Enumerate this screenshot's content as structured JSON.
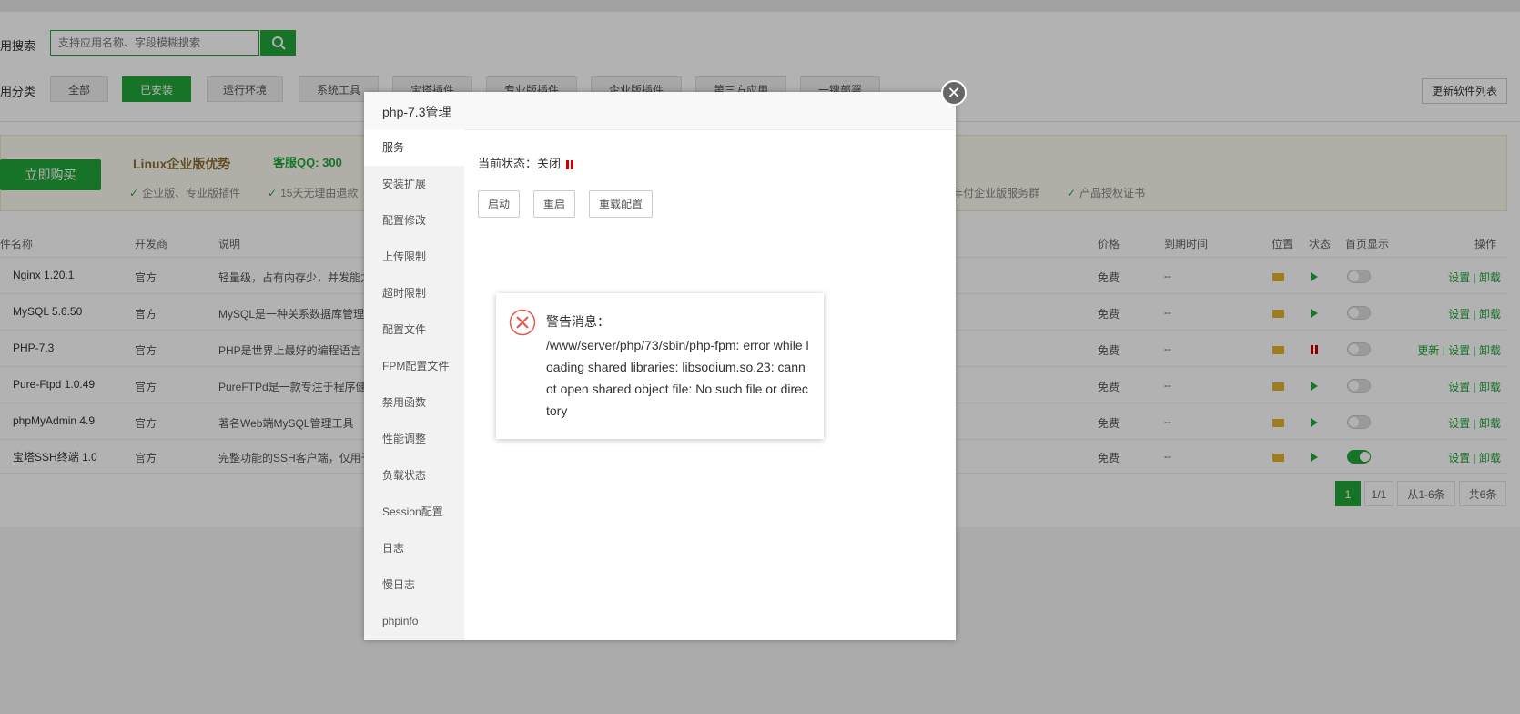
{
  "search": {
    "label": "用搜索",
    "placeholder": "支持应用名称、字段模糊搜索"
  },
  "categories": {
    "label": "用分类",
    "items": [
      "全部",
      "已安装",
      "运行环境",
      "系统工具",
      "宝塔插件",
      "专业版插件",
      "企业版插件",
      "第三方应用",
      "一键部署"
    ],
    "active": "已安装"
  },
  "refresh_label": "更新软件列表",
  "promo": {
    "buy_label": "立即购买",
    "title": "Linux企业版优势",
    "qq": "客服QQ: 300",
    "items": [
      "企业版、专业版插件",
      "15天无理由退款",
      "年付企业版服务群",
      "产品授权证书"
    ]
  },
  "table": {
    "headers": [
      "件名称",
      "开发商",
      "说明",
      "价格",
      "到期时间",
      "位置",
      "状态",
      "首页显示",
      "操作"
    ],
    "rows": [
      {
        "name": "Nginx 1.20.1",
        "vendor": "官方",
        "desc": "轻量级，占有内存少，并发能力",
        "price": "免费",
        "expire": "--",
        "status": "running",
        "home": false,
        "ops": "设置 | 卸载"
      },
      {
        "name": "MySQL 5.6.50",
        "vendor": "官方",
        "desc": "MySQL是一种关系数据库管理",
        "price": "免费",
        "expire": "--",
        "status": "running",
        "home": false,
        "ops": "设置 | 卸载"
      },
      {
        "name": "PHP-7.3",
        "vendor": "官方",
        "desc": "PHP是世界上最好的编程语言",
        "price": "免费",
        "expire": "--",
        "status": "stopped",
        "home": false,
        "ops": "更新 | 设置 | 卸载"
      },
      {
        "name": "Pure-Ftpd 1.0.49",
        "vendor": "官方",
        "desc": "PureFTPd是一款专注于程序健",
        "price": "免费",
        "expire": "--",
        "status": "running",
        "home": false,
        "ops": "设置 | 卸载"
      },
      {
        "name": "phpMyAdmin 4.9",
        "vendor": "官方",
        "desc": "著名Web端MySQL管理工具",
        "price": "免费",
        "expire": "--",
        "status": "running",
        "home": false,
        "ops": "设置 | 卸载"
      },
      {
        "name": "宝塔SSH终端 1.0",
        "vendor": "官方",
        "desc": "完整功能的SSH客户端，仅用于",
        "price": "免费",
        "expire": "--",
        "status": "running",
        "home": true,
        "ops": "设置 | 卸载"
      }
    ]
  },
  "pagination": {
    "current": "1",
    "pages": "1/1",
    "range": "从1-6条",
    "total": "共6条"
  },
  "modal": {
    "title": "php-7.3管理",
    "sidebar": [
      "服务",
      "安装扩展",
      "配置修改",
      "上传限制",
      "超时限制",
      "配置文件",
      "FPM配置文件",
      "禁用函数",
      "性能调整",
      "负载状态",
      "Session配置",
      "日志",
      "慢日志",
      "phpinfo"
    ],
    "active_item": "服务",
    "status_text": "当前状态：关闭",
    "buttons": [
      "启动",
      "重启",
      "重载配置"
    ]
  },
  "alert": {
    "title": "警告消息：",
    "message": "/www/server/php/73/sbin/php-fpm: error while loading shared libraries: libsodium.so.23: cannot open shared object file: No such file or directory"
  },
  "colors": {
    "accent": "#20a53a",
    "danger": "#c00",
    "alert_icon": "#e15c4f"
  }
}
